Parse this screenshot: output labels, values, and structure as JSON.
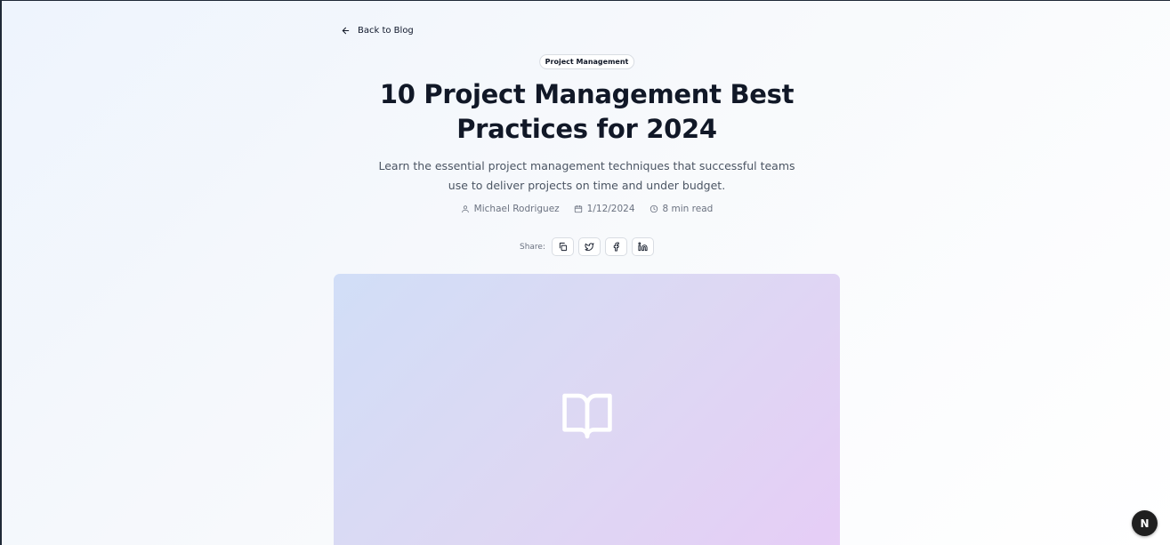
{
  "nav": {
    "back_label": "Back to Blog"
  },
  "post": {
    "category": "Project Management",
    "title": "10 Project Management Best Practices for 2024",
    "excerpt": "Learn the essential project management techniques that successful teams use to deliver projects on time and under budget.",
    "author": "Michael Rodriguez",
    "date": "1/12/2024",
    "read_time": "8 min read"
  },
  "share": {
    "label": "Share:",
    "buttons": [
      {
        "icon": "copy-link-icon"
      },
      {
        "icon": "twitter-icon"
      },
      {
        "icon": "facebook-icon"
      },
      {
        "icon": "linkedin-icon"
      }
    ]
  },
  "hero": {
    "icon": "book-open-icon"
  },
  "dev_badge": {
    "label": "N"
  },
  "colors": {
    "text_primary": "#111827",
    "text_muted": "#6b7280",
    "hero_gradient_start": "#d1def7",
    "hero_gradient_end": "#e6cdf6",
    "badge_bg": "#1f1f1f"
  }
}
